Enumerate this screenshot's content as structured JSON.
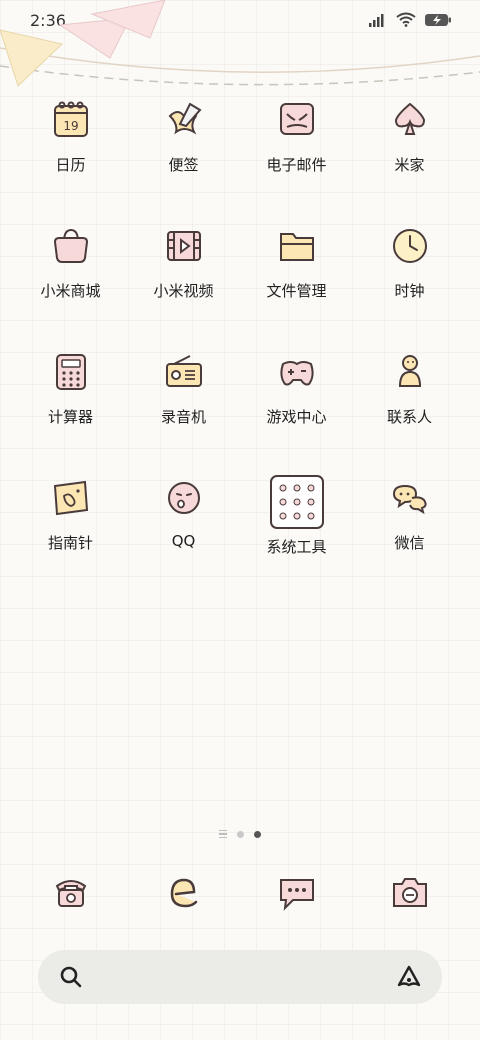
{
  "status_bar": {
    "time": "2:36"
  },
  "apps": [
    {
      "label": "日历",
      "name": "calendar",
      "day": "19"
    },
    {
      "label": "便签",
      "name": "notes"
    },
    {
      "label": "电子邮件",
      "name": "email"
    },
    {
      "label": "米家",
      "name": "mijia"
    },
    {
      "label": "小米商城",
      "name": "mi-store"
    },
    {
      "label": "小米视频",
      "name": "mi-video"
    },
    {
      "label": "文件管理",
      "name": "file-manager"
    },
    {
      "label": "时钟",
      "name": "clock"
    },
    {
      "label": "计算器",
      "name": "calculator"
    },
    {
      "label": "录音机",
      "name": "recorder"
    },
    {
      "label": "游戏中心",
      "name": "game-center"
    },
    {
      "label": "联系人",
      "name": "contacts"
    },
    {
      "label": "指南针",
      "name": "compass"
    },
    {
      "label": "QQ",
      "name": "qq"
    },
    {
      "label": "系统工具",
      "name": "system-tools"
    },
    {
      "label": "微信",
      "name": "wechat"
    }
  ],
  "page_indicator": {
    "pages": 2,
    "current": 2
  },
  "dock": [
    "phone",
    "browser",
    "messages",
    "camera"
  ],
  "colors": {
    "pink": "#f8d9d9",
    "yellow": "#fbe6b4",
    "outline": "#4a3b3b"
  }
}
